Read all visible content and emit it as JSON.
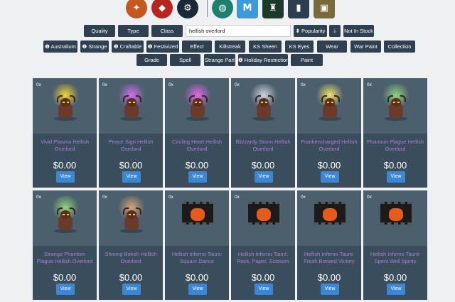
{
  "top_icons": [
    {
      "name": "tf2-icon",
      "glyph": "✦",
      "color": "#c4581e"
    },
    {
      "name": "dota2-icon",
      "glyph": "◆",
      "color": "#b8251d"
    },
    {
      "name": "steam-icon",
      "glyph": "⚙",
      "color": "#1b2838"
    },
    {
      "name": "globe-icon",
      "glyph": "◍",
      "color": "#1d7f6e"
    },
    {
      "name": "marketplace-icon",
      "glyph": "M",
      "color": "#3c9ad9"
    },
    {
      "name": "hat-icon",
      "glyph": "♜",
      "color": "#1c3a2c"
    },
    {
      "name": "backpack-icon",
      "glyph": "▮",
      "color": "#2c3e50"
    },
    {
      "name": "chest-icon",
      "glyph": "▣",
      "color": "#7a6a3a"
    }
  ],
  "filters": {
    "quality": "Quality",
    "type": "Type",
    "class": "Class",
    "search_value": "hellish overlord",
    "sort": "⬍ Popularity",
    "sort_dir": "🡓",
    "not_in_stock": "Not In Stock",
    "row2": [
      "❶ Australium",
      "❶ Strange",
      "❶ Craftable",
      "❶ Festivized",
      "Effect",
      "Killstreak",
      "KS Sheen",
      "KS Eyes",
      "Wear",
      "War Paint",
      "Collection"
    ],
    "row3": [
      "Grade",
      "Spell",
      "Strange Part",
      "❶ Holiday Restriction",
      "Paint"
    ]
  },
  "items": [
    {
      "qty": "0x",
      "name": "Vivid Plasma Hellish Overlord",
      "price": "$0.00",
      "view": "View",
      "effect": "#f6d32d",
      "kind": "unusual"
    },
    {
      "qty": "0x",
      "name": "Peace Sign Hellish Overlord",
      "price": "$0.00",
      "view": "View",
      "effect": "#d26ff0",
      "kind": "unusual"
    },
    {
      "qty": "0x",
      "name": "Circling Heart Hellish Overlord",
      "price": "$0.00",
      "view": "View",
      "effect": "#e368e6",
      "kind": "unusual"
    },
    {
      "qty": "0x",
      "name": "Blizzardy Storm Hellish Overlord",
      "price": "$0.00",
      "view": "View",
      "effect": "#cfd6da",
      "kind": "unusual"
    },
    {
      "qty": "0x",
      "name": "Frankencharged Hellish Overlord",
      "price": "$0.00",
      "view": "View",
      "effect": "#f2e46a",
      "kind": "unusual"
    },
    {
      "qty": "0x",
      "name": "Phantom Plague Hellish Overlord",
      "price": "$0.00",
      "view": "View",
      "effect": "#8fd47a",
      "kind": "unusual"
    },
    {
      "qty": "0x",
      "name": "Strange Phantom Plague Hellish Overlord",
      "price": "$0.00",
      "view": "View",
      "effect": "#8fd47a",
      "kind": "unusual"
    },
    {
      "qty": "0x",
      "name": "Shining Bokeh Hellish Overlord",
      "price": "$0.00",
      "view": "View",
      "effect": "#d8a27a",
      "kind": "unusual"
    },
    {
      "qty": "0x",
      "name": "Hellish Inferno Taunt: Square Dance",
      "price": "$0.00",
      "view": "View",
      "effect": "#e85a1c",
      "kind": "taunt"
    },
    {
      "qty": "0x",
      "name": "Hellish Inferno Taunt: Rock, Paper, Scissors",
      "price": "$0.00",
      "view": "View",
      "effect": "#e85a1c",
      "kind": "taunt"
    },
    {
      "qty": "0x",
      "name": "Hellish Inferno Taunt: Fresh Brewed Victory",
      "price": "$0.00",
      "view": "View",
      "effect": "#e85a1c",
      "kind": "taunt"
    },
    {
      "qty": "0x",
      "name": "Hellish Inferno Taunt: Spent Well Spirits",
      "price": "$0.00",
      "view": "View",
      "effect": "#e85a1c",
      "kind": "taunt"
    }
  ]
}
